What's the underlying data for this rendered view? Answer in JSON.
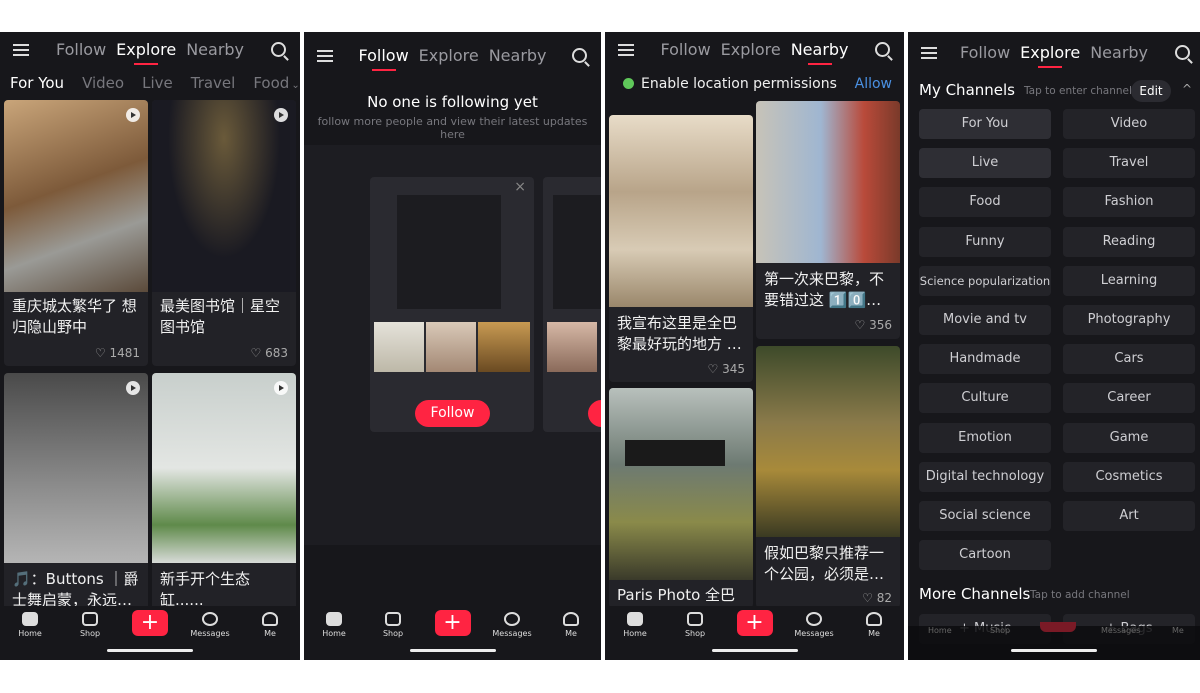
{
  "top_tabs": [
    "Follow",
    "Explore",
    "Nearby"
  ],
  "bottom_nav": {
    "home": "Home",
    "shop": "Shop",
    "messages": "Messages",
    "me": "Me",
    "plus": "+"
  },
  "colors": {
    "accent": "#ff2442",
    "background": "#17171b",
    "link": "#4a90e2"
  },
  "explore": {
    "active_tab": "Explore",
    "subtabs": [
      "For You",
      "Video",
      "Live",
      "Travel",
      "Food"
    ],
    "cards": [
      {
        "caption": "重庆城太繁华了 想归隐山野中",
        "likes": "1481",
        "video": true
      },
      {
        "caption": "最美图书馆｜星空图书馆",
        "likes": "683",
        "video": true
      },
      {
        "caption": "🎵：Buttons ｜爵士舞启蒙，永远…",
        "video": true
      },
      {
        "caption": "新手开个生态缸......",
        "video": true
      }
    ]
  },
  "follow": {
    "active_tab": "Follow",
    "empty_title": "No one is following yet",
    "empty_subtitle": "follow more people and view their latest updates here",
    "follow_button": "Follow",
    "close": "×"
  },
  "nearby": {
    "active_tab": "Nearby",
    "location_prompt": "Enable location permissions",
    "allow": "Allow",
    "cards": [
      {
        "caption": "我宣布这里是全巴黎最好玩的地方 …",
        "likes": "345"
      },
      {
        "caption": "第一次来巴黎，不要错过这 1️⃣0️⃣…",
        "likes": "356"
      },
      {
        "caption": "Paris Photo 全巴黎"
      },
      {
        "caption": "假如巴黎只推荐一个公园，必须是…",
        "likes": "82"
      }
    ]
  },
  "channels": {
    "active_tab": "Explore",
    "my_title": "My Channels",
    "my_hint": "Tap to enter channel",
    "edit": "Edit",
    "my": [
      "For You",
      "Video",
      "Live",
      "Travel",
      "Food",
      "Fashion",
      "Funny",
      "Reading",
      "Science popularization",
      "Learning",
      "Movie and tv",
      "Photography",
      "Handmade",
      "Cars",
      "Culture",
      "Career",
      "Emotion",
      "Game",
      "Digital technology",
      "Cosmetics",
      "Social science",
      "Art",
      "Cartoon"
    ],
    "selected": [
      "For You",
      "Live"
    ],
    "more_title": "More Channels",
    "more_hint": "Tap to add channel",
    "more": [
      "+ Music",
      "+ Bags"
    ]
  }
}
